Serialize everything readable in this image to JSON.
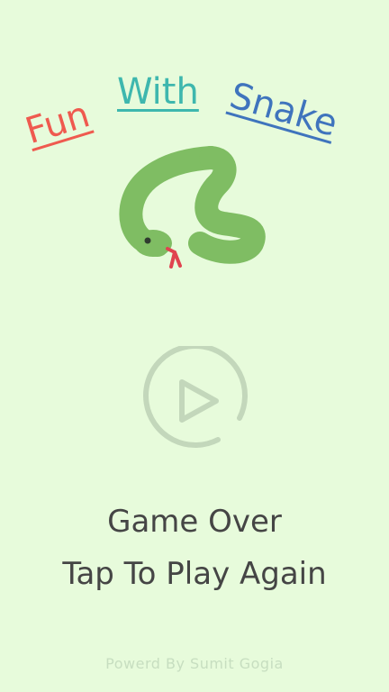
{
  "title": {
    "word1": "Fun",
    "word2": "With",
    "word3": "Snake",
    "colors": {
      "word1": "#ef5a4f",
      "word2": "#3eb7ae",
      "word3": "#3f74bd"
    }
  },
  "mascot": {
    "icon": "snake-icon",
    "body_color": "#7fbd63",
    "tongue_color": "#e0434f"
  },
  "controls": {
    "play_icon": "play-icon",
    "play_color": "#c3d7bb"
  },
  "status": {
    "line1": "Game Over",
    "line2": "Tap To Play Again"
  },
  "footer": {
    "credit": "Powerd By Sumit Gogia"
  },
  "theme": {
    "background": "#e7fbdb",
    "text": "#454545",
    "footer_text": "#c7dec0"
  }
}
